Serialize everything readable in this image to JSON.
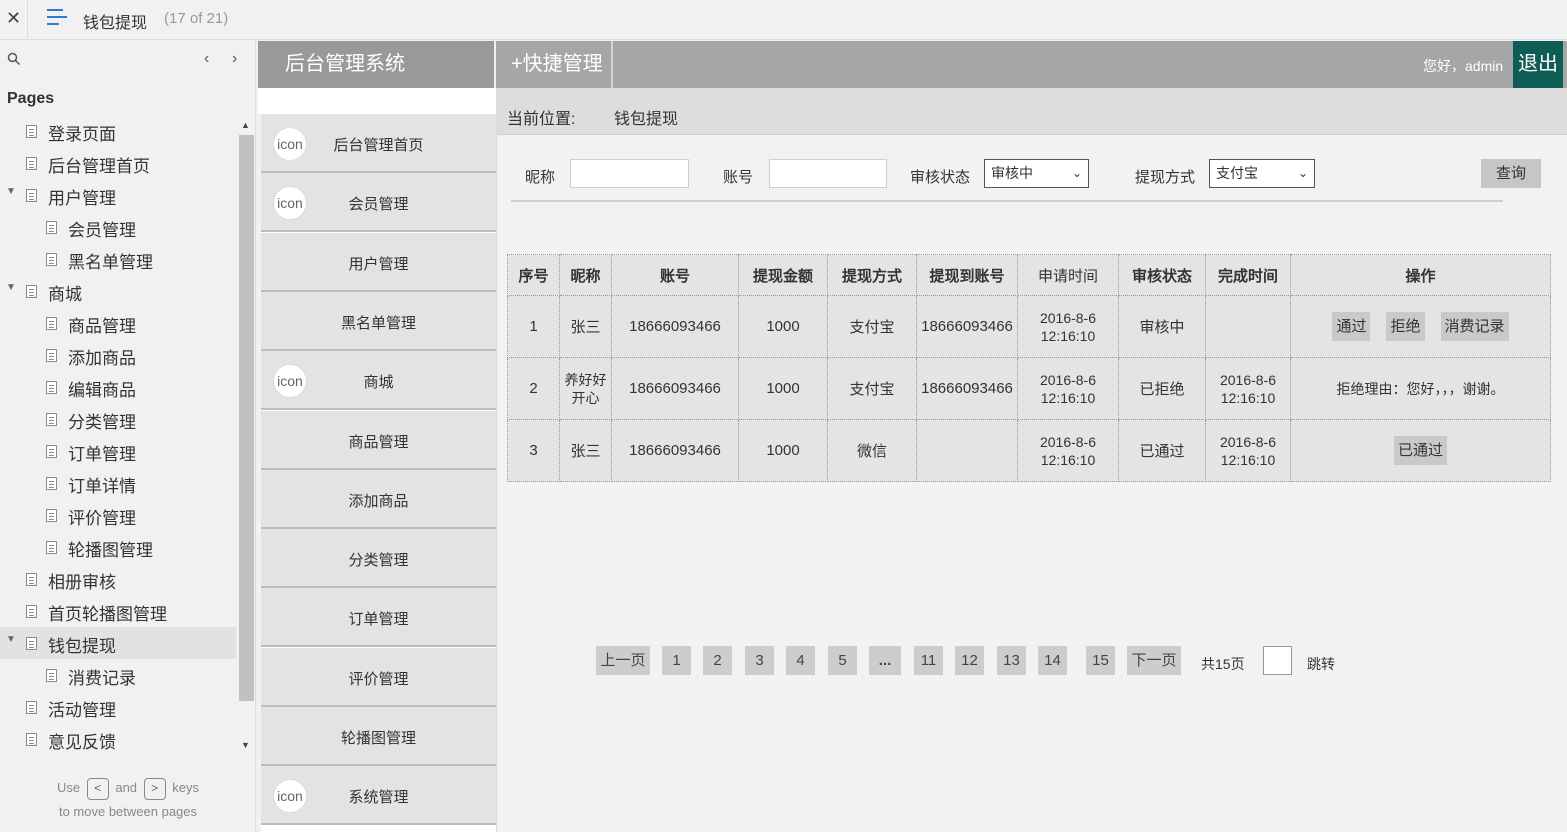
{
  "viewer": {
    "close_glyph": "✕",
    "doc_title": "钱包提现",
    "doc_count": "(17 of 21)",
    "pages_heading": "Pages",
    "hint_use": "Use",
    "hint_and": "and",
    "hint_keys": "keys",
    "hint_line2": "to move between pages",
    "key_prev": "<",
    "key_next": ">"
  },
  "page_tree": [
    {
      "label": "登录页面",
      "level": 0,
      "arrow": false
    },
    {
      "label": "后台管理首页",
      "level": 0,
      "arrow": false
    },
    {
      "label": "用户管理",
      "level": 0,
      "arrow": true
    },
    {
      "label": "会员管理",
      "level": 1,
      "arrow": false
    },
    {
      "label": "黑名单管理",
      "level": 1,
      "arrow": false
    },
    {
      "label": "商城",
      "level": 0,
      "arrow": true
    },
    {
      "label": "商品管理",
      "level": 1,
      "arrow": false
    },
    {
      "label": "添加商品",
      "level": 1,
      "arrow": false
    },
    {
      "label": "编辑商品",
      "level": 1,
      "arrow": false
    },
    {
      "label": "分类管理",
      "level": 1,
      "arrow": false
    },
    {
      "label": "订单管理",
      "level": 1,
      "arrow": false
    },
    {
      "label": "订单详情",
      "level": 1,
      "arrow": false
    },
    {
      "label": "评价管理",
      "level": 1,
      "arrow": false
    },
    {
      "label": "轮播图管理",
      "level": 1,
      "arrow": false
    },
    {
      "label": "相册审核",
      "level": 0,
      "arrow": false
    },
    {
      "label": "首页轮播图管理",
      "level": 0,
      "arrow": false
    },
    {
      "label": "钱包提现",
      "level": 0,
      "arrow": true,
      "active": true
    },
    {
      "label": "消费记录",
      "level": 1,
      "arrow": false
    },
    {
      "label": "活动管理",
      "level": 0,
      "arrow": false
    },
    {
      "label": "意见反馈",
      "level": 0,
      "arrow": false
    }
  ],
  "app": {
    "logo": "后台管理系统",
    "quick_manage": "+快捷管理",
    "greeting": "您好，admin",
    "logout": "退出"
  },
  "menu": [
    {
      "label": "后台管理首页",
      "icon": true
    },
    {
      "label": "会员管理",
      "icon": true
    },
    {
      "label": "用户管理",
      "icon": false
    },
    {
      "label": "黑名单管理",
      "icon": false
    },
    {
      "label": "商城",
      "icon": true
    },
    {
      "label": "商品管理",
      "icon": false
    },
    {
      "label": "添加商品",
      "icon": false
    },
    {
      "label": "分类管理",
      "icon": false
    },
    {
      "label": "订单管理",
      "icon": false
    },
    {
      "label": "评价管理",
      "icon": false
    },
    {
      "label": "轮播图管理",
      "icon": false
    },
    {
      "label": "系统管理",
      "icon": true
    }
  ],
  "menu_icon_text": "icon",
  "breadcrumb": {
    "label": "当前位置:",
    "current": "钱包提现"
  },
  "filters": {
    "nickname_label": "昵称",
    "nickname_value": "",
    "account_label": "账号",
    "account_value": "",
    "status_label": "审核状态",
    "status_value": "审核中",
    "method_label": "提现方式",
    "method_value": "支付宝",
    "query_button": "查询"
  },
  "table": {
    "headers": [
      "序号",
      "昵称",
      "账号",
      "提现金额",
      "提现方式",
      "提现到账号",
      "申请时间",
      "审核状态",
      "完成时间",
      "操作"
    ],
    "rows": [
      {
        "no": "1",
        "nickname": "张三",
        "account": "18666093466",
        "amount": "1000",
        "method": "支付宝",
        "to_account": "18666093466",
        "apply_date": "2016-8-6",
        "apply_time": "12:16:10",
        "status": "审核中",
        "done_date": "",
        "done_time": ""
      },
      {
        "no": "2",
        "nickname": "养好好开心",
        "account": "18666093466",
        "amount": "1000",
        "method": "支付宝",
        "to_account": "18666093466",
        "apply_date": "2016-8-6",
        "apply_time": "12:16:10",
        "status": "已拒绝",
        "done_date": "2016-8-6",
        "done_time": "12:16:10"
      },
      {
        "no": "3",
        "nickname": "张三",
        "account": "18666093466",
        "amount": "1000",
        "method": "微信",
        "to_account": "",
        "apply_date": "2016-8-6",
        "apply_time": "12:16:10",
        "status": "已通过",
        "done_date": "2016-8-6",
        "done_time": "12:16:10"
      }
    ],
    "ops": {
      "approve": "通过",
      "reject": "拒绝",
      "records": "消费记录",
      "reject_reason": "拒绝理由：您好，，，谢谢。",
      "approved": "已通过"
    }
  },
  "pagination": {
    "prev": "上一页",
    "pages": [
      "1",
      "2",
      "3",
      "4",
      "5"
    ],
    "ellipsis": "...",
    "pages_tail": [
      "11",
      "12",
      "13",
      "14",
      "15"
    ],
    "next": "下一页",
    "total": "共15页",
    "jump": "跳转"
  }
}
